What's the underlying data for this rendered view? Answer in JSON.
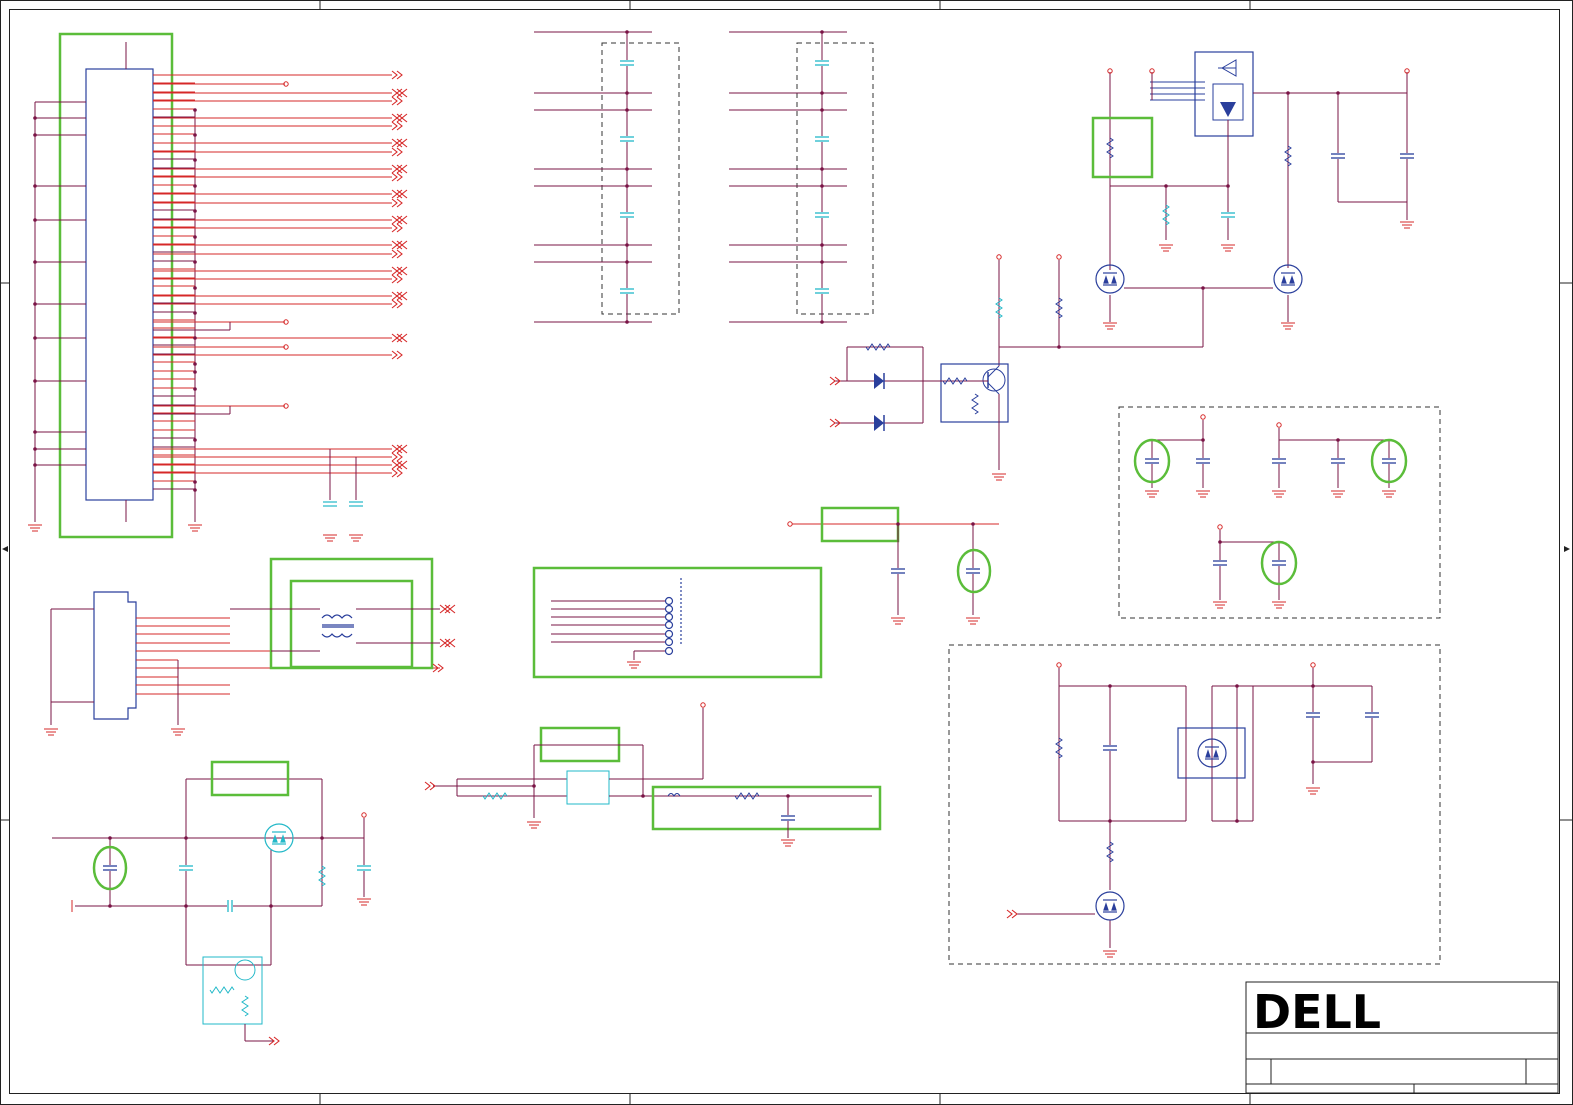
{
  "title_block": {
    "logo_text": "DELL",
    "brand_color": "#000000"
  },
  "colors": {
    "wire": "#7a1446",
    "net": "#d62828",
    "component": "#2a3f9c",
    "passive_cyan": "#22b8c8",
    "highlight": "#5bbd3a",
    "frame": "#222222",
    "dashed_group": "#333333"
  },
  "symbols": {
    "connectors": [
      "main-connector",
      "small-connector",
      "header-connector"
    ],
    "transistors": [
      "mosfet",
      "npn-transistor"
    ],
    "diodes": [
      "zener-diode",
      "switch-diode"
    ],
    "other": [
      "transformer",
      "ground",
      "capacitor",
      "resistor",
      "off-page-connector"
    ]
  }
}
